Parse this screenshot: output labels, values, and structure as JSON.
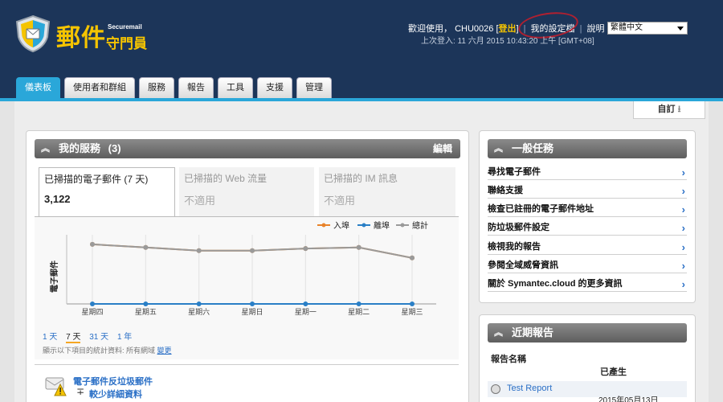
{
  "app": {
    "logo_cn": "郵件",
    "logo_cn_sub": "守門員",
    "logo_en": "Securemail"
  },
  "userbar": {
    "welcome": "歡迎使用，",
    "username": "CHU0026",
    "logout": "登出",
    "my_settings": "我的設定檔",
    "help": "說明",
    "language": "繁體中文",
    "last_login": "上次登入: 11 六月 2015 10:43:20 上午 [GMT+08]"
  },
  "tabs": [
    "儀表板",
    "使用者和群組",
    "服務",
    "報告",
    "工具",
    "支援",
    "管理"
  ],
  "customize_label": "自訂",
  "services_panel": {
    "title": "我的服務",
    "count": "(3)",
    "edit": "編輯",
    "tiles": [
      {
        "label": "已掃描的電子郵件 (7 天)",
        "value": "3,122"
      },
      {
        "label": "已掃描的 Web 流量",
        "value": "不適用"
      },
      {
        "label": "已掃描的 IM 訊息",
        "value": "不適用"
      }
    ],
    "ranges": [
      "1 天",
      "7 天",
      "31 天",
      "1 年"
    ],
    "footnote": "顯示以下項目的統計資料: 所有網域",
    "footnote_link": "變更",
    "spam_title": "電子郵件反垃圾郵件",
    "spam_more": "較少詳細資料",
    "spam_plus": "∓"
  },
  "chart_data": {
    "type": "line",
    "ylabel": "電子郵件",
    "categories": [
      "星期四",
      "星期五",
      "星期六",
      "星期日",
      "星期一",
      "星期二",
      "星期三"
    ],
    "series": [
      {
        "name": "入埠",
        "color": "#e8832a",
        "values": [
          570,
          540,
          510,
          510,
          530,
          540,
          440
        ]
      },
      {
        "name": "離埠",
        "color": "#2a7fc6",
        "values": [
          0,
          0,
          0,
          0,
          0,
          0,
          0
        ]
      },
      {
        "name": "總計",
        "color": "#9a9a9a",
        "values": [
          570,
          540,
          510,
          510,
          530,
          540,
          440
        ]
      }
    ],
    "grid": true,
    "legend": "top-right"
  },
  "tasks_panel": {
    "title": "一般任務",
    "items": [
      "尋找電子郵件",
      "聯絡支援",
      "檢查已註冊的電子郵件地址",
      "防垃圾郵件設定",
      "檢視我的報告",
      "參閱全域威脅資訊",
      "關於 Symantec.cloud 的更多資訊"
    ]
  },
  "reports_panel": {
    "title": "近期報告",
    "col_name": "報告名稱",
    "col_generated": "已產生",
    "rows": [
      {
        "name": "Test Report",
        "date": "2015年05月13日"
      }
    ]
  },
  "colors": {
    "header_bg": "#1c3559",
    "accent": "#2aa7d9",
    "brand_yellow": "#f5c400",
    "link": "#2a6fc6"
  }
}
